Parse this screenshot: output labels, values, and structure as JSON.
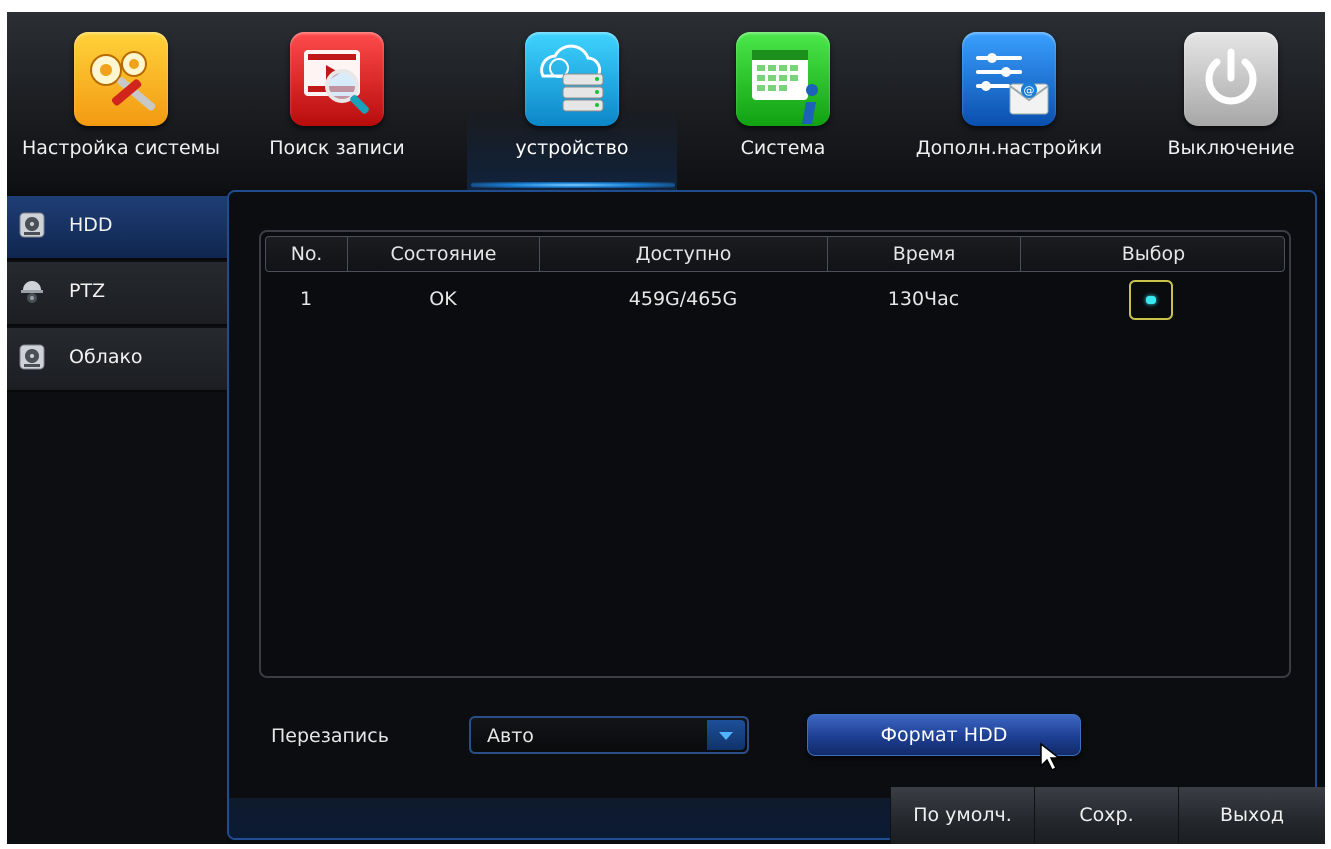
{
  "nav": {
    "items": [
      {
        "label": "Настройка системы",
        "icon": "gears-tools-icon"
      },
      {
        "label": "Поиск записи",
        "icon": "record-search-icon"
      },
      {
        "label": "устройство",
        "icon": "cloud-storage-icon"
      },
      {
        "label": "Система",
        "icon": "calendar-info-icon"
      },
      {
        "label": "Дополн.настройки",
        "icon": "settings-mail-icon"
      },
      {
        "label": "Выключение",
        "icon": "power-icon"
      }
    ],
    "active_index": 2
  },
  "sidebar": {
    "items": [
      {
        "label": "HDD",
        "icon": "hdd-icon"
      },
      {
        "label": "PTZ",
        "icon": "ptz-camera-icon"
      },
      {
        "label": "Облако",
        "icon": "hdd-icon"
      }
    ],
    "active_index": 0
  },
  "hdd_table": {
    "columns": [
      "No.",
      "Состояние",
      "Доступно",
      "Время",
      "Выбор"
    ],
    "rows": [
      {
        "no": "1",
        "status": "OK",
        "available": "459G/465G",
        "time": "130Час",
        "selected": true
      }
    ]
  },
  "overwrite": {
    "label": "Перезапись",
    "value": "Авто"
  },
  "format_button_label": "Формат HDD",
  "footer": {
    "default_label": "По умолч.",
    "save_label": "Сохр.",
    "exit_label": "Выход"
  },
  "colors": {
    "accent_blue": "#1f4d8f",
    "selection_yellow": "#c9c24a",
    "selection_cyan": "#3ce8f0"
  }
}
